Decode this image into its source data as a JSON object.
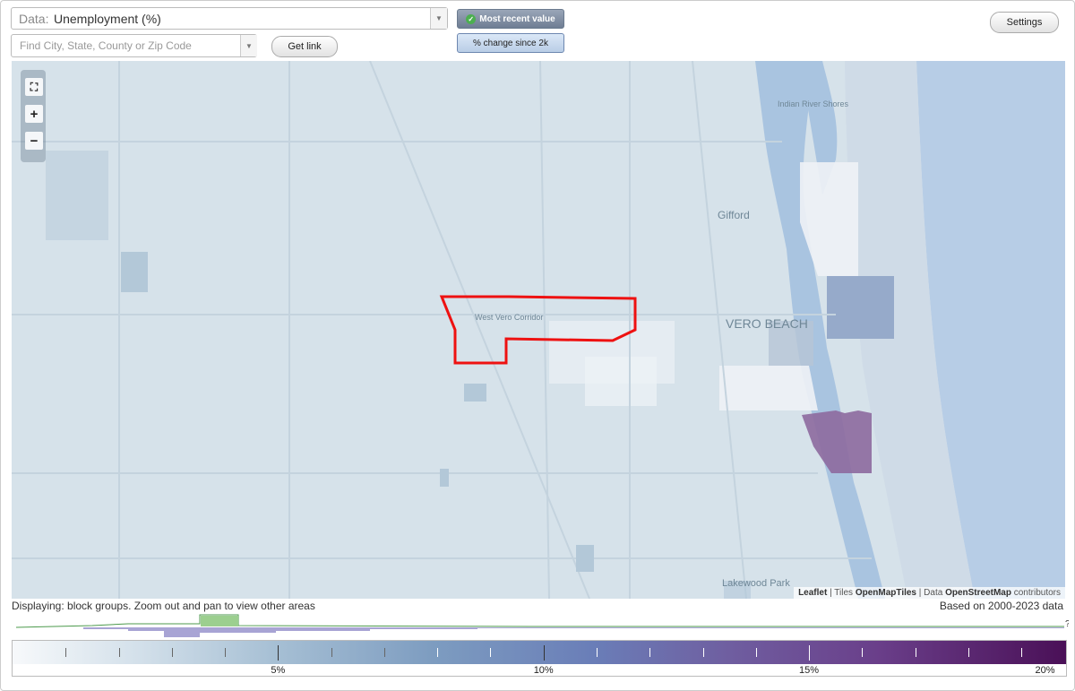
{
  "controls": {
    "data_prefix": "Data:",
    "data_value": "Unemployment (%)",
    "search_placeholder": "Find City, State, County or Zip Code",
    "get_link": "Get link",
    "most_recent": "Most recent value",
    "pct_change": "% change since 2k",
    "settings": "Settings"
  },
  "map": {
    "labels": {
      "indian_river_shores": "Indian River Shores",
      "gifford": "Gifford",
      "vero_beach": "VERO BEACH",
      "west_vero": "West Vero Corridor",
      "lakewood": "Lakewood Park"
    },
    "attribution": {
      "leaflet": "Leaflet",
      "tiles": "Tiles",
      "omt": "OpenMapTiles",
      "data": "Data",
      "osm": "OpenStreetMap",
      "contributors": "contributors"
    },
    "colors": {
      "highlight": "#ee1111",
      "water": "#a9c4e0",
      "land": "#d6e2ea"
    }
  },
  "footer": {
    "displaying": "Displaying: block groups. Zoom out and pan to view other areas",
    "based_on": "Based on 2000-2023 data",
    "unknown": "?"
  },
  "legend": {
    "labels": [
      "5%",
      "10%",
      "15%",
      "20%"
    ],
    "range": [
      0,
      20
    ]
  }
}
